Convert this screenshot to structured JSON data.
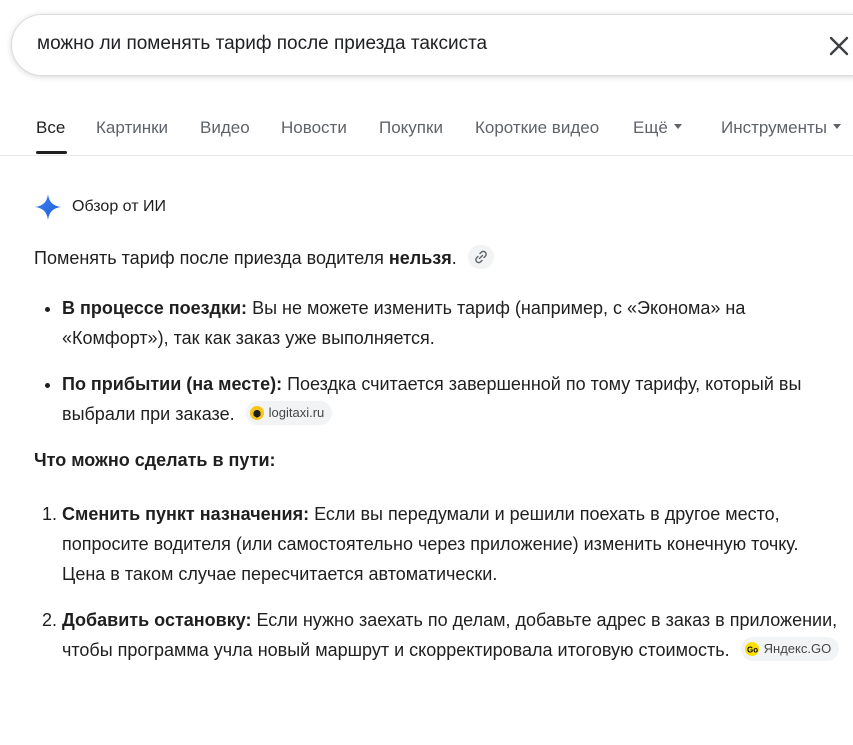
{
  "search": {
    "query": "можно ли поменять тариф после приезда таксиста"
  },
  "tabs": [
    {
      "label": "Все",
      "active": true
    },
    {
      "label": "Картинки"
    },
    {
      "label": "Видео"
    },
    {
      "label": "Новости"
    },
    {
      "label": "Покупки"
    },
    {
      "label": "Короткие видео"
    },
    {
      "label": "Ещё"
    },
    {
      "label": "Инструменты"
    }
  ],
  "ai_overview": {
    "header": "Обзор от ИИ",
    "intro_text": "Поменять тариф после приезда водителя ",
    "intro_bold": "нельзя",
    "intro_end": ".",
    "bullets": [
      {
        "bold": "В процессе поездки:",
        "text": " Вы не можете изменить тариф (например, с «Эконома» на «Комфорт»), так как заказ уже выполняется."
      },
      {
        "bold": "По прибытии (на месте):",
        "text": " Поездка считается завершенной по тому тарифу, который вы выбрали при заказе.",
        "source": "logitaxi.ru"
      }
    ],
    "subheading": "Что можно сделать в пути:",
    "steps": [
      {
        "bold": "Сменить пункт назначения:",
        "text": " Если вы передумали и решили поехать в другое место, попросите водителя (или самостоятельно через приложение) изменить конечную точку. Цена в таком случае пересчитается автоматически."
      },
      {
        "bold": "Добавить остановку:",
        "text": " Если нужно заехать по делам, добавьте адрес в заказ в приложении, чтобы программа учла новый маршрут и скорректировала итоговую стоимость.",
        "source": "Яндекс.GO"
      }
    ]
  },
  "colors": {
    "accent_blue": "#4285f4",
    "text_primary": "#1f1f1f",
    "text_secondary": "#5f6368",
    "chip_bg": "#f1f3f4"
  },
  "icons": {
    "clear": "close-icon",
    "ai": "gemini-sparkle-icon",
    "link": "link-icon"
  }
}
